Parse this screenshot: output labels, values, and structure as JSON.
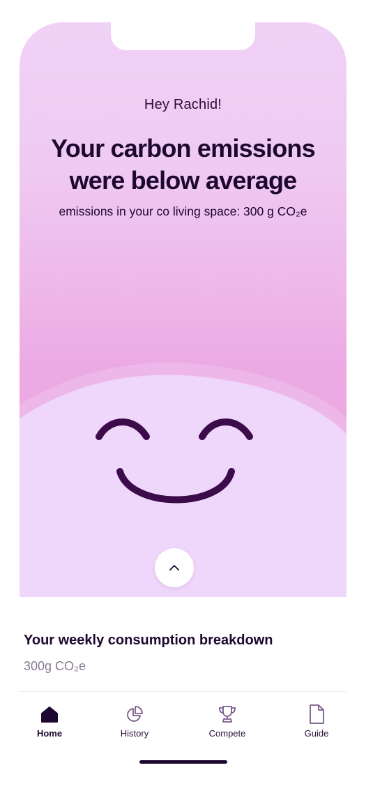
{
  "hero": {
    "greeting": "Hey Rachid!",
    "headline_line1": "Your carbon emissions",
    "headline_line2": "were below average",
    "subline": "emissions in your co living space: 300 g CO₂e",
    "mood_icon": "smiling-face",
    "expand_icon": "chevron-up-icon"
  },
  "breakdown": {
    "title": "Your weekly consumption breakdown",
    "value": "300g CO₂e"
  },
  "tabs": [
    {
      "label": "Home",
      "icon": "home-icon",
      "active": true
    },
    {
      "label": "History",
      "icon": "pie-chart-icon",
      "active": false
    },
    {
      "label": "Compete",
      "icon": "trophy-icon",
      "active": false
    },
    {
      "label": "Guide",
      "icon": "document-icon",
      "active": false
    }
  ],
  "colors": {
    "hero_top": "#f0d2f7",
    "hero_bottom": "#eaa4e0",
    "hill": "#efd6fb",
    "ink": "#1d0830",
    "face": "#3b0b4a",
    "muted": "#8a7a92"
  }
}
